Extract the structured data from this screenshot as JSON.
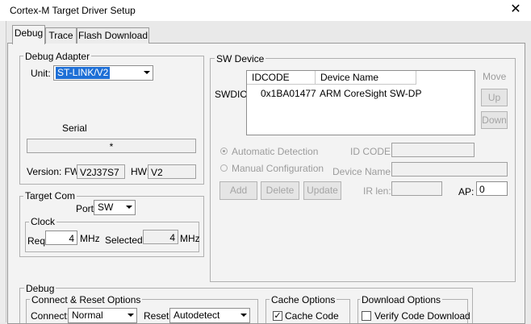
{
  "window": {
    "title": "Cortex-M Target Driver Setup",
    "close_glyph": "✕"
  },
  "tabs": [
    {
      "label": "Debug",
      "active": true
    },
    {
      "label": "Trace",
      "active": false
    },
    {
      "label": "Flash Download",
      "active": false
    }
  ],
  "debug_adapter": {
    "legend": "Debug Adapter",
    "unit_label": "Unit:",
    "unit_value": "ST-LINK/V2",
    "serial_label": "Serial",
    "serial_value": "*",
    "version_label": "Version: FW:",
    "fw_value": "V2J37S7",
    "hw_label": "HW:",
    "hw_value": "V2"
  },
  "target_com": {
    "legend": "Target Com",
    "port_label": "Port:",
    "port_value": "SW"
  },
  "clock": {
    "legend": "Clock",
    "req_label": "Req:",
    "req_value": "4",
    "req_unit": "MHz",
    "selected_label": "Selected:",
    "selected_value": "4",
    "selected_unit": "MHz"
  },
  "sw_device": {
    "legend": "SW Device",
    "side_label": "SWDIO",
    "columns": [
      "IDCODE",
      "Device Name"
    ],
    "rows": [
      {
        "idcode": "0x1BA01477",
        "device_name": "ARM CoreSight SW-DP"
      }
    ],
    "move_label": "Move",
    "up_label": "Up",
    "down_label": "Down",
    "auto_detection_label": "Automatic Detection",
    "manual_config_label": "Manual Configuration",
    "idcode_label": "ID CODE:",
    "idcode_value": "",
    "device_name_label": "Device Name:",
    "device_name_value": "",
    "add_label": "Add",
    "delete_label": "Delete",
    "update_label": "Update",
    "ir_len_label": "IR len:",
    "ir_len_value": "",
    "ap_label": "AP:",
    "ap_value": "0"
  },
  "debug_section": {
    "legend": "Debug",
    "connect_reset": {
      "legend": "Connect & Reset Options",
      "connect_label": "Connect:",
      "connect_value": "Normal",
      "reset_label": "Reset:",
      "reset_value": "Autodetect"
    },
    "cache_options": {
      "legend": "Cache Options",
      "cache_code_label": "Cache Code",
      "cache_code_checked": true
    },
    "download_options": {
      "legend": "Download Options",
      "verify_label": "Verify Code Download",
      "verify_checked": false
    }
  },
  "colors": {
    "selection": "#1e6fd6",
    "panel": "#f3f3f3",
    "disabled_text": "#9c9c9c"
  }
}
